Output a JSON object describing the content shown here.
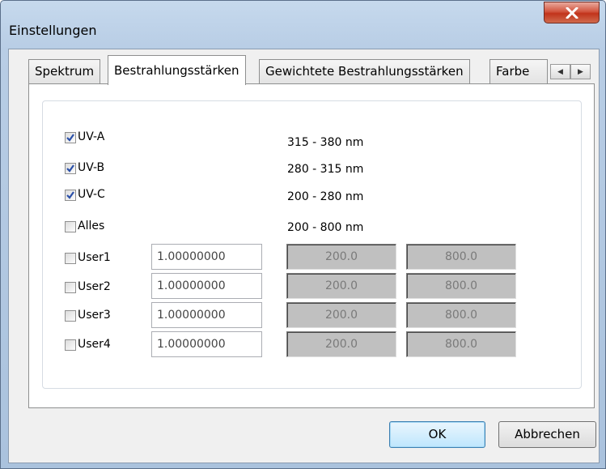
{
  "window": {
    "title": "Einstellungen",
    "close_label": "X"
  },
  "tabs": [
    {
      "label": "Spektrum"
    },
    {
      "label": "Bestrahlungsstärken"
    },
    {
      "label": "Gewichtete Bestrahlungsstärken"
    },
    {
      "label": "Farbe"
    }
  ],
  "active_tab": "Bestrahlungsstärken",
  "ranges": [
    {
      "label": "UV-A",
      "checked": true,
      "range": "315 - 380 nm"
    },
    {
      "label": "UV-B",
      "checked": true,
      "range": "280 - 315 nm"
    },
    {
      "label": "UV-C",
      "checked": true,
      "range": "200 - 280 nm"
    },
    {
      "label": "Alles",
      "checked": false,
      "range": "200 - 800 nm"
    }
  ],
  "users": [
    {
      "label": "User1",
      "checked": false,
      "factor": "1.00000000",
      "from": "200.0",
      "to": "800.0"
    },
    {
      "label": "User2",
      "checked": false,
      "factor": "1.00000000",
      "from": "200.0",
      "to": "800.0"
    },
    {
      "label": "User3",
      "checked": false,
      "factor": "1.00000000",
      "from": "200.0",
      "to": "800.0"
    },
    {
      "label": "User4",
      "checked": false,
      "factor": "1.00000000",
      "from": "200.0",
      "to": "800.0"
    }
  ],
  "buttons": {
    "ok": "OK",
    "cancel": "Abbrechen"
  },
  "colors": {
    "checkmark": "#2a4fa8",
    "ok_border": "#3c7fb1",
    "close_button": "#c1331b"
  }
}
